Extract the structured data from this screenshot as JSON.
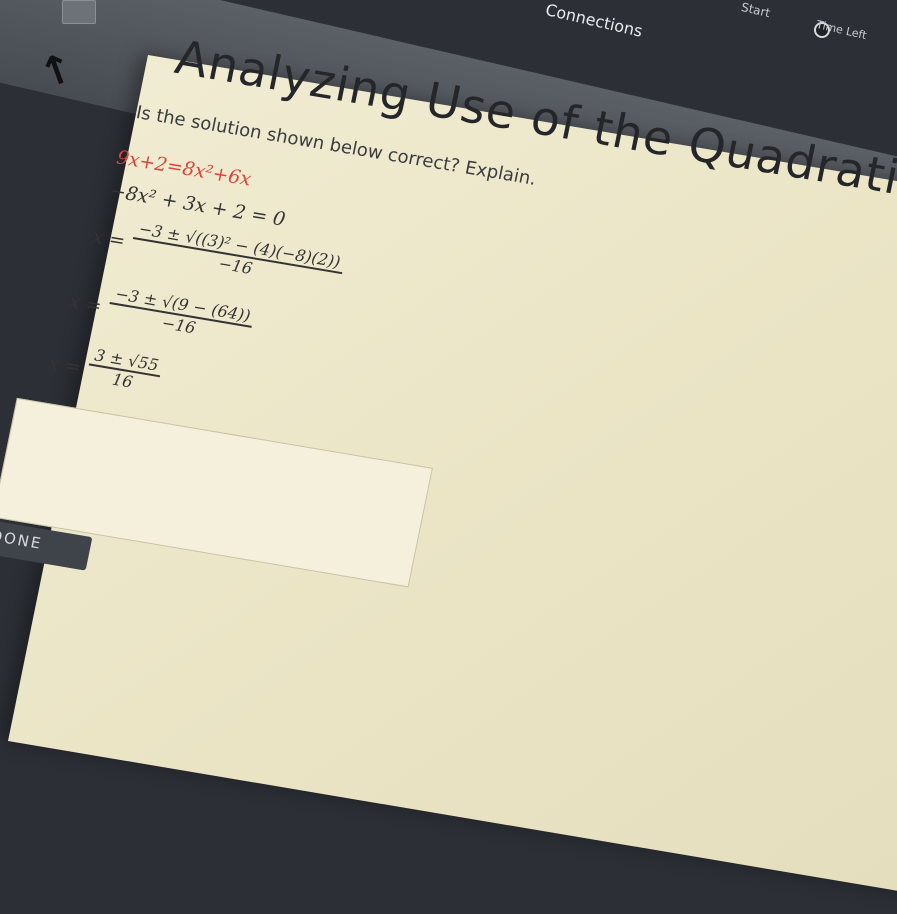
{
  "app": {
    "connections_label": "Connections",
    "start_label": "Start",
    "time_left_label": "Time Left"
  },
  "page": {
    "title": "Analyzing Use of the Quadratic Formula",
    "question": "Is the solution shown below correct? Explain."
  },
  "work": {
    "line1": "9x+2=8x²+6x",
    "line2": "−8x² + 3x + 2 = 0",
    "line3_lhs": "x =",
    "line3_num": "−3 ± √((3)² − (4)(−8)(2))",
    "line3_den": "−16",
    "line4_lhs": "x =",
    "line4_num": "−3 ± √(9 − (64))",
    "line4_den": "−16",
    "line5_lhs": "x =",
    "line5_num": "3 ± √55",
    "line5_den": "16"
  },
  "actions": {
    "done_label": "DONE"
  },
  "colors": {
    "highlight_red": "#d9453a",
    "panel": "#ebe5c6"
  }
}
